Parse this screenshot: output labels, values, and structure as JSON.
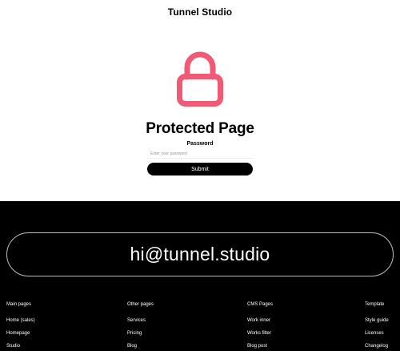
{
  "header": {
    "brand": "Tunnel Studio"
  },
  "protected": {
    "icon": "lock-icon",
    "icon_color": "#ef5a76",
    "title": "Protected Page",
    "password_label": "Password",
    "password_placeholder": "Enter your password",
    "submit_label": "Submit"
  },
  "footer": {
    "email": "hi@tunnel.studio",
    "columns": [
      {
        "heading": "Main pages",
        "links": [
          "Home (sales)",
          "Homepage",
          "Studio"
        ]
      },
      {
        "heading": "Other pages",
        "links": [
          "Services",
          "Pricing",
          "Blog"
        ]
      },
      {
        "heading": "CMS Pages",
        "links": [
          "Work inner",
          "Works filter",
          "Blog post"
        ]
      },
      {
        "heading": "Template",
        "links": [
          "Style guide",
          "Licenses",
          "Changelog"
        ]
      }
    ]
  }
}
